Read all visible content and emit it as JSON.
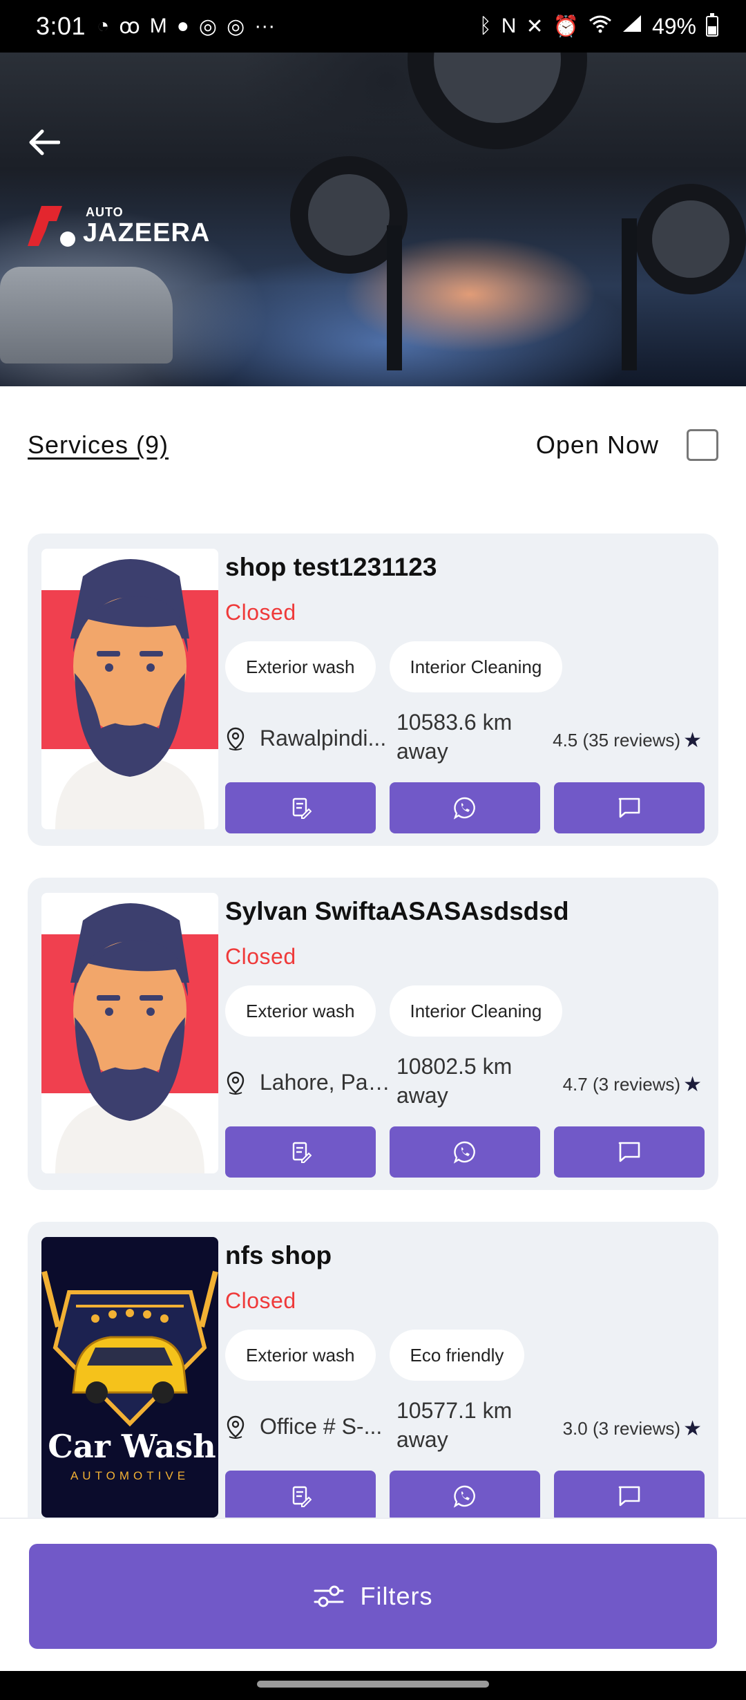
{
  "status_bar": {
    "time": "3:01",
    "battery": "49%",
    "left_icons": [
      "do-not-disturb-icon",
      "voicemail-icon",
      "gmail-icon",
      "apple-icon",
      "chrome-icon",
      "chrome-icon",
      "more-icon"
    ],
    "right_icons": [
      "bluetooth-icon",
      "nfc-icon",
      "mute-icon",
      "alarm-icon",
      "wifi-icon",
      "signal-icon",
      "battery-icon"
    ]
  },
  "header": {
    "back_icon": "arrow-left-icon",
    "logo_small": "AUTO",
    "logo_big": "JAZEERA"
  },
  "filter_row": {
    "services_label": "Services (9)",
    "open_now_label": "Open Now",
    "open_now_checked": false
  },
  "shops": [
    {
      "name": "shop test1231123",
      "status": "Closed",
      "tags": [
        "Exterior wash",
        "Interior Cleaning"
      ],
      "location": "Rawalpindi...",
      "distance": "10583.6 km away",
      "rating": "4.5 (35 reviews)",
      "avatar": "bearded-man-avatar"
    },
    {
      "name": "Sylvan SwiftaASASAsdsdsd",
      "status": "Closed",
      "tags": [
        "Exterior wash",
        "Interior Cleaning"
      ],
      "location": "Lahore, Paki...",
      "distance": "10802.5 km away",
      "rating": "4.7 (3 reviews)",
      "avatar": "bearded-man-avatar"
    },
    {
      "name": "nfs shop",
      "status": "Closed",
      "tags": [
        "Exterior wash",
        "Eco friendly"
      ],
      "location": "Office # S-...",
      "distance": "10577.1 km away",
      "rating": "3.0 (3 reviews)",
      "avatar": "car-wash-logo",
      "avatar_text": "Car Wash",
      "avatar_subtext": "AUTOMOTIVE"
    }
  ],
  "card_actions": [
    "book-icon",
    "whatsapp-icon",
    "chat-icon"
  ],
  "bottom": {
    "filters_label": "Filters",
    "filters_icon": "sliders-icon"
  },
  "colors": {
    "accent": "#7159c8",
    "closed": "#ef3a3a",
    "card_bg": "#eef1f5"
  }
}
